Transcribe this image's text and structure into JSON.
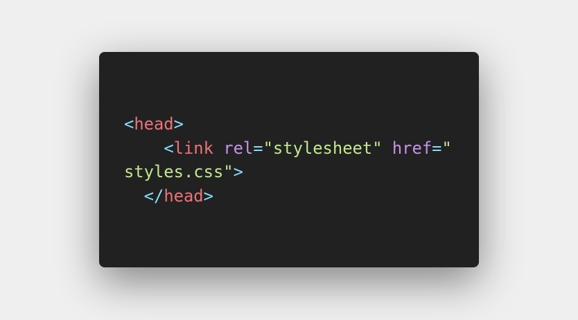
{
  "code": {
    "lines": [
      [
        {
          "k": "p",
          "v": "<"
        },
        {
          "k": "t",
          "v": "head"
        },
        {
          "k": "p",
          "v": ">"
        }
      ],
      [
        {
          "k": "x",
          "v": "    "
        },
        {
          "k": "p",
          "v": "<"
        },
        {
          "k": "t",
          "v": "link"
        },
        {
          "k": "x",
          "v": " "
        },
        {
          "k": "a",
          "v": "rel"
        },
        {
          "k": "p",
          "v": "="
        },
        {
          "k": "s",
          "v": "\"stylesheet\""
        },
        {
          "k": "x",
          "v": " "
        },
        {
          "k": "a",
          "v": "href"
        },
        {
          "k": "p",
          "v": "="
        },
        {
          "k": "s",
          "v": "\""
        }
      ],
      [
        {
          "k": "s",
          "v": "styles.css\""
        },
        {
          "k": "p",
          "v": ">"
        }
      ],
      [
        {
          "k": "x",
          "v": "  "
        },
        {
          "k": "p",
          "v": "</"
        },
        {
          "k": "t",
          "v": "head"
        },
        {
          "k": "p",
          "v": ">"
        }
      ]
    ]
  },
  "colors": {
    "background": "#212121",
    "punctuation": "#89ddff",
    "tag": "#f07178",
    "attribute": "#c792ea",
    "string": "#c3e88d"
  }
}
